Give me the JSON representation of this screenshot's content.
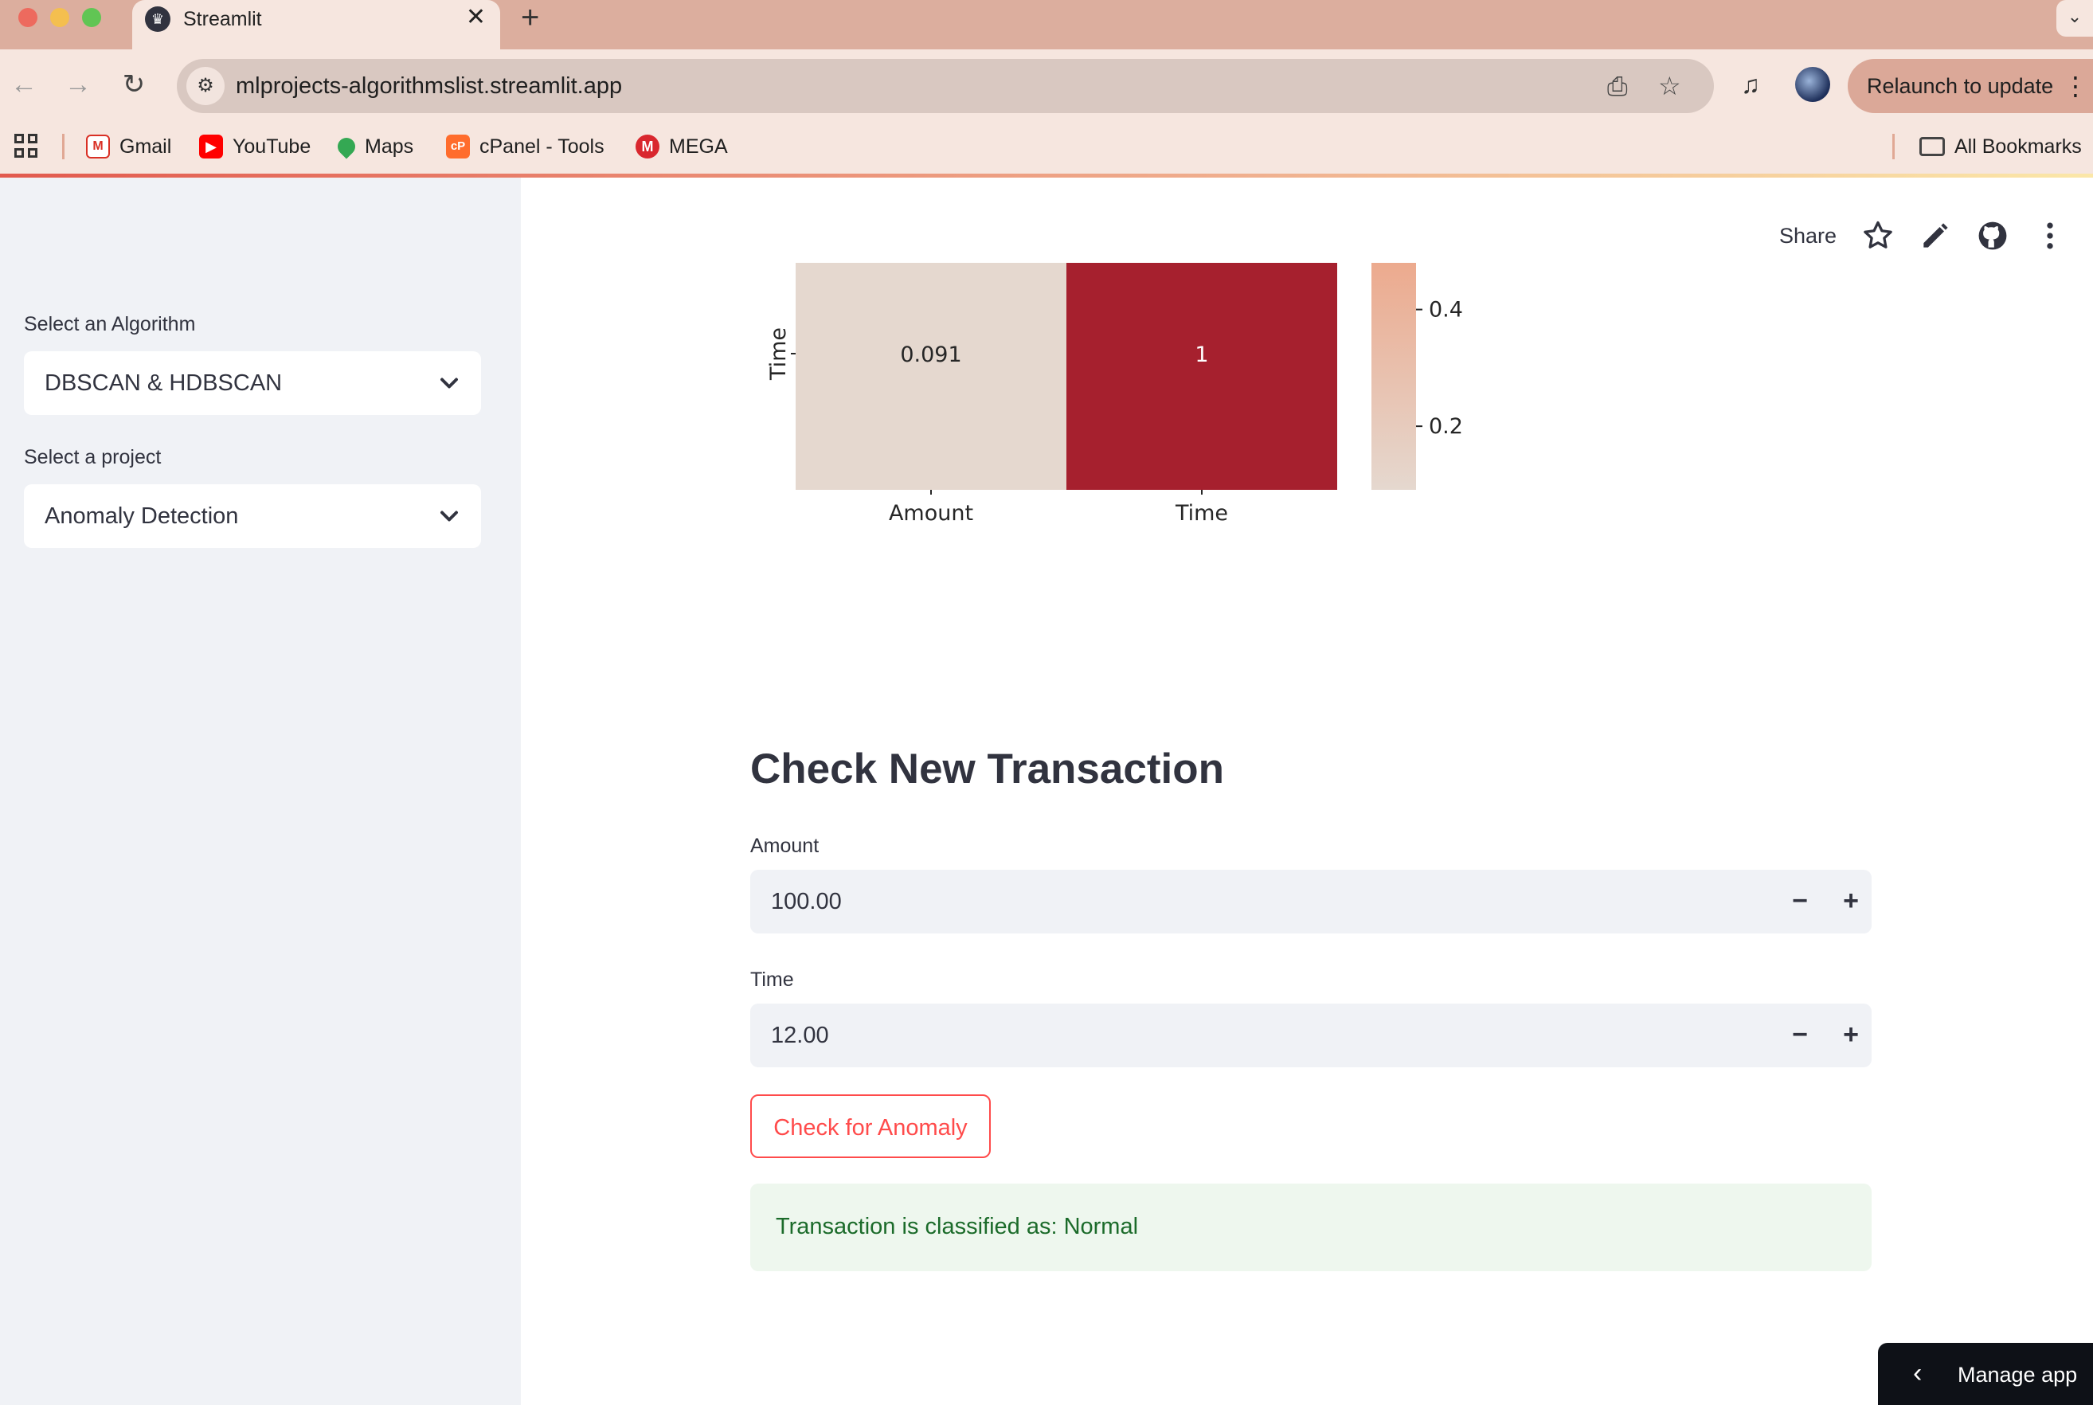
{
  "browser": {
    "tab_title": "Streamlit",
    "url": "mlprojects-algorithmslist.streamlit.app",
    "relaunch_label": "Relaunch to update",
    "bookmarks": [
      {
        "label": "Gmail",
        "icon": "gmail-icon",
        "color": "#d93025"
      },
      {
        "label": "YouTube",
        "icon": "youtube-icon",
        "color": "#ff0000"
      },
      {
        "label": "Maps",
        "icon": "maps-icon",
        "color": "#34a853"
      },
      {
        "label": "cPanel - Tools",
        "icon": "cpanel-icon",
        "color": "#ff6c2c"
      },
      {
        "label": "MEGA",
        "icon": "mega-icon",
        "color": "#d9272e"
      }
    ],
    "all_bookmarks_label": "All Bookmarks"
  },
  "sidebar": {
    "algorithm_label": "Select an Algorithm",
    "algorithm_value": "DBSCAN & HDBSCAN",
    "project_label": "Select a project",
    "project_value": "Anomaly Detection"
  },
  "toolbar": {
    "share_label": "Share"
  },
  "chart_data": {
    "type": "heatmap",
    "x_categories": [
      "Amount",
      "Time"
    ],
    "y_categories": [
      "Time"
    ],
    "values": [
      [
        0.091,
        1
      ]
    ],
    "annotations": [
      "0.091",
      "1"
    ],
    "colorbar_ticks": [
      "0.4",
      "0.2"
    ],
    "colorbar_tick_values": [
      0.4,
      0.2
    ],
    "colorbar_range": [
      0.091,
      0.48
    ],
    "colors": {
      "low": "#e5d8cf",
      "mid": "#ecaa8e",
      "high": "#a6202e"
    }
  },
  "form": {
    "heading": "Check New Transaction",
    "amount_label": "Amount",
    "amount_value": "100.00",
    "time_label": "Time",
    "time_value": "12.00",
    "submit_label": "Check for Anomaly",
    "result_text": "Transaction is classified as: Normal"
  },
  "manage_app_label": "Manage app",
  "colors": {
    "accent": "#ff4b4b",
    "success_bg": "#eef7ee",
    "success_text": "#1b6b2a",
    "sidebar_bg": "#f0f2f6"
  }
}
